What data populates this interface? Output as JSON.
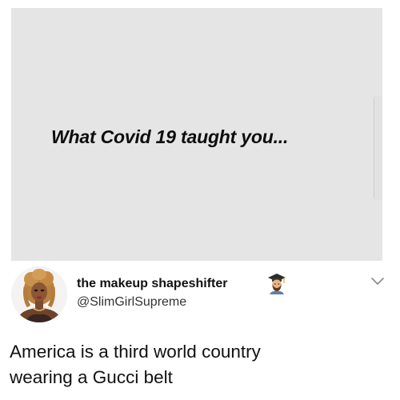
{
  "image_card": {
    "headline": "What Covid 19 taught you..."
  },
  "tweet": {
    "display_name": "the makeup shapeshifter",
    "handle": "@SlimGirlSupreme",
    "badge_icon": "student-emoji-icon",
    "menu_icon": "chevron-down-icon",
    "text_lines": [
      "America is a third world country",
      "wearing a Gucci belt"
    ]
  }
}
